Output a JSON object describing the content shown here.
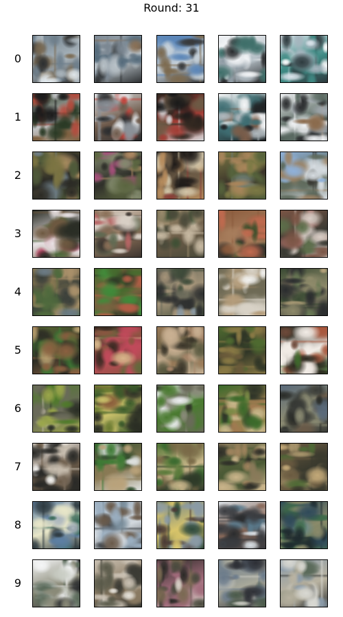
{
  "title": "Round: 31",
  "rows": [
    {
      "label": "0",
      "samples": [
        {
          "palette": [
            "#6e7f8c",
            "#2c2f31",
            "#a9b4bb",
            "#7a6a52",
            "#dfe6ea"
          ]
        },
        {
          "palette": [
            "#7b8792",
            "#2f3234",
            "#b9c2c8",
            "#8a7055",
            "#546a7a"
          ]
        },
        {
          "palette": [
            "#5b86b8",
            "#37393b",
            "#c4cfd8",
            "#7c6a4f",
            "#9aa8b4"
          ]
        },
        {
          "palette": [
            "#f2f4f6",
            "#2a2c2e",
            "#b6c0c7",
            "#3f6f6a",
            "#8d9aa3"
          ]
        },
        {
          "palette": [
            "#d9e3ea",
            "#2e3b3f",
            "#3f8a84",
            "#a5b5be",
            "#ffffff"
          ]
        }
      ]
    },
    {
      "label": "1",
      "samples": [
        {
          "palette": [
            "#2a3a25",
            "#7b5d3c",
            "#c4c6c8",
            "#b34a3c",
            "#1b1b1b"
          ]
        },
        {
          "palette": [
            "#e2e4e6",
            "#2b2d2f",
            "#6e5a4b",
            "#c2423a",
            "#8b9198"
          ]
        },
        {
          "palette": [
            "#30261f",
            "#d4d6d8",
            "#a13d35",
            "#6d5a45",
            "#1a1a1a"
          ]
        },
        {
          "palette": [
            "#f4f5f6",
            "#202224",
            "#3f6e73",
            "#b0b8bd",
            "#7c5d49"
          ]
        },
        {
          "palette": [
            "#eef0f2",
            "#2c2e30",
            "#5b6b63",
            "#a3aab0",
            "#8a6a4c"
          ]
        }
      ]
    },
    {
      "label": "2",
      "samples": [
        {
          "palette": [
            "#7b7442",
            "#4f5a3a",
            "#2b2a25",
            "#a98d60",
            "#6e7d86"
          ]
        },
        {
          "palette": [
            "#838a6e",
            "#5b6540",
            "#2f2f2a",
            "#b08a63",
            "#a64f7b"
          ]
        },
        {
          "palette": [
            "#1f1b19",
            "#b78c5d",
            "#6b5a45",
            "#d2c5a8",
            "#8a3d37"
          ]
        },
        {
          "palette": [
            "#7c7a45",
            "#55623b",
            "#3a3329",
            "#a9855b",
            "#6d7b73"
          ]
        },
        {
          "palette": [
            "#8fb1d9",
            "#d7dde2",
            "#5e6a5c",
            "#3a3a34",
            "#9b8366"
          ]
        }
      ]
    },
    {
      "label": "3",
      "samples": [
        {
          "palette": [
            "#2a2d25",
            "#6d5840",
            "#e8e2e4",
            "#b23a5a",
            "#4c6a3a"
          ]
        },
        {
          "palette": [
            "#d9d0c6",
            "#3d3530",
            "#8a6f57",
            "#b76565",
            "#5f6a52"
          ]
        },
        {
          "palette": [
            "#9a8a6c",
            "#4a4a3a",
            "#6b5c47",
            "#c7b9a2",
            "#3e4f34"
          ]
        },
        {
          "palette": [
            "#8a5a3c",
            "#3d4f2b",
            "#a77d5c",
            "#2b2b28",
            "#c06a4f"
          ]
        },
        {
          "palette": [
            "#7a5545",
            "#d8cdc6",
            "#3a3a33",
            "#a06a63",
            "#5c6e4a"
          ]
        }
      ]
    },
    {
      "label": "4",
      "samples": [
        {
          "palette": [
            "#8a7a52",
            "#4f6a3d",
            "#3a3f3a",
            "#a9906a",
            "#6c7c86"
          ]
        },
        {
          "palette": [
            "#476b2e",
            "#2f3a26",
            "#7a6440",
            "#3e8c3a",
            "#b25c45"
          ]
        },
        {
          "palette": [
            "#6a6a5a",
            "#3f4c3a",
            "#a6957a",
            "#2e3030",
            "#8b9aa4"
          ]
        },
        {
          "palette": [
            "#b49c7a",
            "#d8d2c6",
            "#6e6a55",
            "#a58a66",
            "#f2f2f0"
          ]
        },
        {
          "palette": [
            "#3a4a33",
            "#2a2c2e",
            "#8e8a6a",
            "#6a7a55",
            "#b9a47c"
          ]
        }
      ]
    },
    {
      "label": "5",
      "samples": [
        {
          "palette": [
            "#5a6a35",
            "#8a6040",
            "#2e2e25",
            "#b8a070",
            "#3e7a35"
          ]
        },
        {
          "palette": [
            "#3a2a22",
            "#8a5540",
            "#c04a5a",
            "#5e6a3a",
            "#d8b48a"
          ]
        },
        {
          "palette": [
            "#9a7a58",
            "#c9b092",
            "#5a5a40",
            "#3a3529",
            "#a8866a"
          ]
        },
        {
          "palette": [
            "#4e6a30",
            "#8a7a45",
            "#2f3526",
            "#b9a16c",
            "#6a5a3a"
          ]
        },
        {
          "palette": [
            "#2c2a20",
            "#3e6a2c",
            "#f2ece6",
            "#a8583e",
            "#6e4a3a"
          ]
        }
      ]
    },
    {
      "label": "6",
      "samples": [
        {
          "palette": [
            "#4f7a2a",
            "#9aa64a",
            "#6a6a5a",
            "#2a2e25",
            "#b8b2a0"
          ]
        },
        {
          "palette": [
            "#6a7a32",
            "#3a5a2a",
            "#c9c06a",
            "#8a5a3a",
            "#2a2d24"
          ]
        },
        {
          "palette": [
            "#eef0f2",
            "#6a6a5a",
            "#4a7a30",
            "#8a8a7a",
            "#2e3027"
          ]
        },
        {
          "palette": [
            "#3a6a2a",
            "#7a8a45",
            "#a07a50",
            "#2f3428",
            "#c8b78a"
          ]
        },
        {
          "palette": [
            "#5a6a7a",
            "#3a3c38",
            "#8a8a72",
            "#2a2c28",
            "#6a5a48"
          ]
        }
      ]
    },
    {
      "label": "7",
      "samples": [
        {
          "palette": [
            "#f6f4f2",
            "#2a2a27",
            "#6a5a48",
            "#c9bfb0",
            "#4a5a3a"
          ]
        },
        {
          "palette": [
            "#2d4a2a",
            "#dfe2e0",
            "#8a7a55",
            "#3e7a35",
            "#b9a27a"
          ]
        },
        {
          "palette": [
            "#5a7a3a",
            "#2e3a28",
            "#c8b58a",
            "#7a6a48",
            "#3a6a2f"
          ]
        },
        {
          "palette": [
            "#8a7a5a",
            "#c9b48a",
            "#4a5a35",
            "#2f2f28",
            "#a0845e"
          ]
        },
        {
          "palette": [
            "#6a5a40",
            "#a8956c",
            "#3a3a2e",
            "#c2a878",
            "#4e6a35"
          ]
        }
      ]
    },
    {
      "label": "8",
      "samples": [
        {
          "palette": [
            "#5d7fa2",
            "#2e3a40",
            "#e8e6c8",
            "#a9b4bd",
            "#3a6a5a"
          ]
        },
        {
          "palette": [
            "#9aaec0",
            "#3a3f44",
            "#d2d8dd",
            "#6a5a4a",
            "#7a8e9c"
          ]
        },
        {
          "palette": [
            "#6a8090",
            "#2f4a3a",
            "#d8c46a",
            "#8a9aa5",
            "#4a3a35"
          ]
        },
        {
          "palette": [
            "#d9dfe4",
            "#3a3c40",
            "#8a6a5a",
            "#5a7a8c",
            "#2a2c2e"
          ]
        },
        {
          "palette": [
            "#2f4a5a",
            "#3e6a4a",
            "#8a8a6a",
            "#1e2a2e",
            "#6a8a8a"
          ]
        }
      ]
    },
    {
      "label": "9",
      "samples": [
        {
          "palette": [
            "#f4f5f6",
            "#2a2c2e",
            "#8a8a78",
            "#c9cdc4",
            "#5a6a5a"
          ]
        },
        {
          "palette": [
            "#c9c0b2",
            "#3a3a34",
            "#8a7a62",
            "#e6e2da",
            "#5a5a4a"
          ]
        },
        {
          "palette": [
            "#2a2a26",
            "#d8d2c8",
            "#a06a7a",
            "#7a6a52",
            "#4a4a3e"
          ]
        },
        {
          "palette": [
            "#6a7a8a",
            "#2e3036",
            "#a8a89a",
            "#4a5a4a",
            "#c8c8c0"
          ]
        },
        {
          "palette": [
            "#8a9aa8",
            "#3a3c3a",
            "#b8b2a0",
            "#5a6a5a",
            "#d8d8d2"
          ]
        }
      ]
    }
  ]
}
